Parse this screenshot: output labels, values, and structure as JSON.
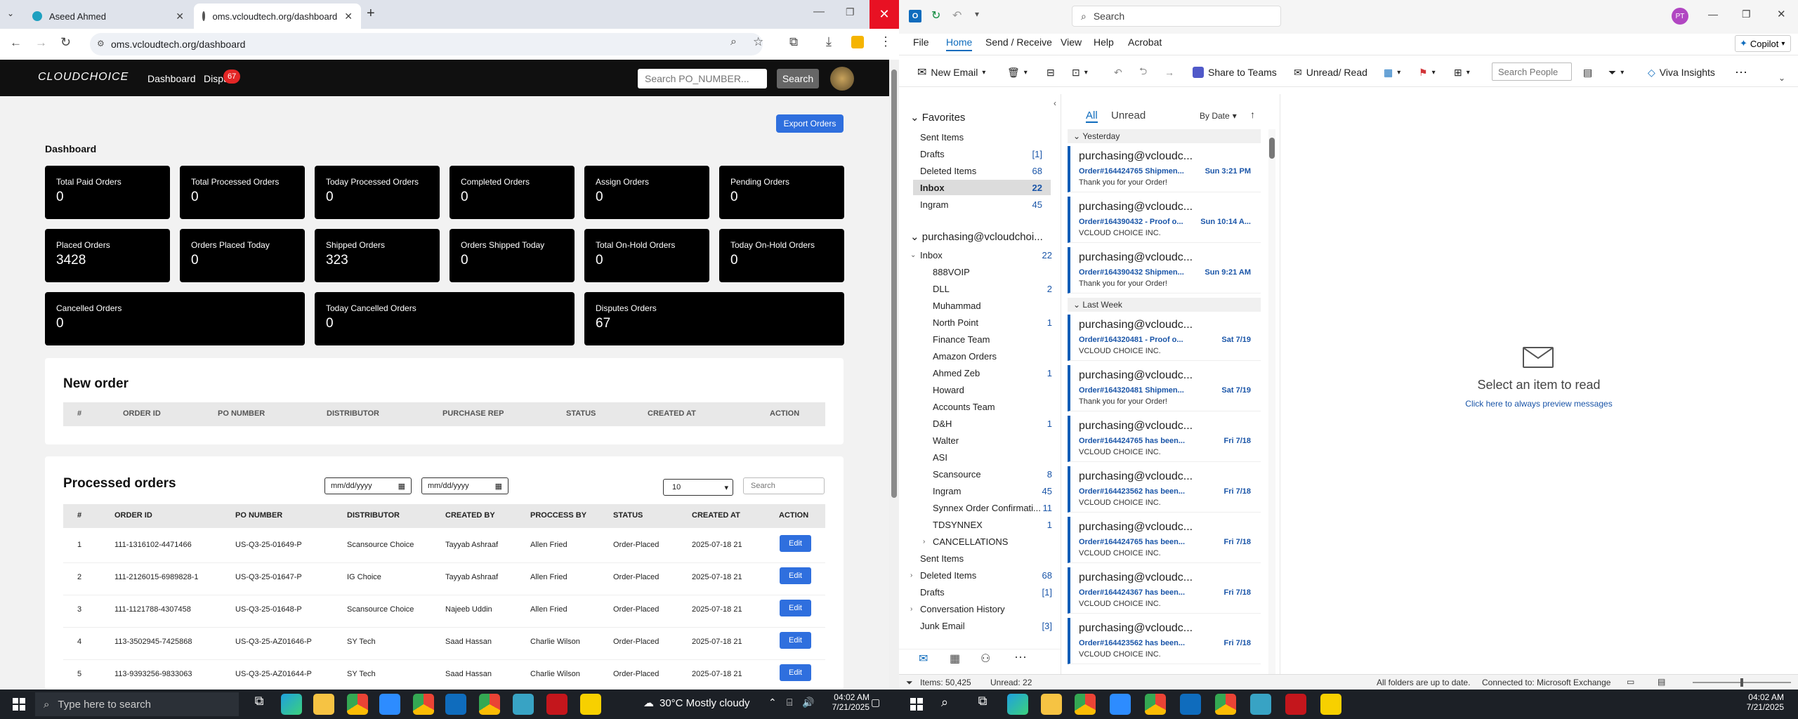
{
  "browser": {
    "tabs": [
      {
        "label": "Aseed Ahmed",
        "active": false
      },
      {
        "label": "oms.vcloudtech.org/dashboard",
        "active": true
      }
    ],
    "new_tab": "+",
    "url": "oms.vcloudtech.org/dashboard"
  },
  "oms": {
    "logo": "CLOUDCHOICE",
    "nav": {
      "dashboard": "Dashboard",
      "disputes": "Dispu",
      "disputes_badge": "67"
    },
    "search_placeholder": "Search PO_NUMBER...",
    "search_button": "Search",
    "export_button": "Export Orders",
    "page_title": "Dashboard",
    "cards": [
      {
        "label": "Total Paid Orders",
        "value": "0"
      },
      {
        "label": "Total Processed Orders",
        "value": "0"
      },
      {
        "label": "Today Processed Orders",
        "value": "0"
      },
      {
        "label": "Completed Orders",
        "value": "0"
      },
      {
        "label": "Assign Orders",
        "value": "0"
      },
      {
        "label": "Pending Orders",
        "value": "0"
      },
      {
        "label": "Placed Orders",
        "value": "3428"
      },
      {
        "label": "Orders Placed Today",
        "value": "0"
      },
      {
        "label": "Shipped Orders",
        "value": "323"
      },
      {
        "label": "Orders Shipped Today",
        "value": "0"
      },
      {
        "label": "Total On-Hold Orders",
        "value": "0"
      },
      {
        "label": "Today On-Hold Orders",
        "value": "0"
      },
      {
        "label": "Cancelled Orders",
        "value": "0"
      },
      {
        "label": "Today Cancelled Orders",
        "value": "0"
      },
      {
        "label": "Disputes Orders",
        "value": "67"
      }
    ],
    "new_order": {
      "title": "New order",
      "headers": [
        "#",
        "ORDER ID",
        "PO NUMBER",
        "DISTRIBUTOR",
        "PURCHASE REP",
        "STATUS",
        "CREATED AT",
        "ACTION"
      ]
    },
    "processed": {
      "title": "Processed orders",
      "date_placeholder": "mm/dd/yyyy",
      "page_size": "10",
      "search_placeholder": "Search",
      "headers": [
        "#",
        "ORDER ID",
        "PO NUMBER",
        "DISTRIBUTOR",
        "CREATED BY",
        "PROCCESS BY",
        "STATUS",
        "CREATED AT",
        "ACTION"
      ],
      "rows": [
        [
          "1",
          "111-1316102-4471466",
          "US-Q3-25-01649-P",
          "Scansource Choice",
          "Tayyab Ashraaf",
          "Allen Fried",
          "Order-Placed",
          "2025-07-18 21"
        ],
        [
          "2",
          "111-2126015-6989828-1",
          "US-Q3-25-01647-P",
          "IG Choice",
          "Tayyab Ashraaf",
          "Allen Fried",
          "Order-Placed",
          "2025-07-18 21"
        ],
        [
          "3",
          "111-1121788-4307458",
          "US-Q3-25-01648-P",
          "Scansource Choice",
          "Najeeb Uddin",
          "Allen Fried",
          "Order-Placed",
          "2025-07-18 21"
        ],
        [
          "4",
          "113-3502945-7425868",
          "US-Q3-25-AZ01646-P",
          "SY Tech",
          "Saad Hassan",
          "Charlie Wilson",
          "Order-Placed",
          "2025-07-18 21"
        ],
        [
          "5",
          "113-9393256-9833063",
          "US-Q3-25-AZ01644-P",
          "SY Tech",
          "Saad Hassan",
          "Charlie Wilson",
          "Order-Placed",
          "2025-07-18 21"
        ]
      ],
      "edit": "Edit"
    }
  },
  "outlook": {
    "search": "Search",
    "avatar": "PT",
    "copilot": "Copilot",
    "menu": [
      "File",
      "Home",
      "Send / Receive",
      "View",
      "Help",
      "Acrobat"
    ],
    "ribbon": {
      "new_email": "New Email",
      "share_teams": "Share to Teams",
      "unread_read": "Unread/ Read",
      "search_people": "Search People",
      "viva": "Viva Insights"
    },
    "favorites_label": "Favorites",
    "favorites": [
      {
        "name": "Sent Items",
        "count": ""
      },
      {
        "name": "Drafts",
        "count": "[1]"
      },
      {
        "name": "Deleted Items",
        "count": "68"
      },
      {
        "name": "Inbox",
        "count": "22"
      },
      {
        "name": "Ingram",
        "count": "45"
      }
    ],
    "account": "purchasing@vcloudchoi...",
    "folders": [
      {
        "name": "Inbox",
        "count": "22"
      },
      {
        "name": "888VOIP",
        "count": ""
      },
      {
        "name": "DLL",
        "count": "2"
      },
      {
        "name": "Muhammad",
        "count": ""
      },
      {
        "name": "North Point",
        "count": "1"
      },
      {
        "name": "Finance Team",
        "count": ""
      },
      {
        "name": "Amazon Orders",
        "count": ""
      },
      {
        "name": "Ahmed Zeb",
        "count": "1"
      },
      {
        "name": "Howard",
        "count": ""
      },
      {
        "name": "Accounts Team",
        "count": ""
      },
      {
        "name": "D&H",
        "count": "1"
      },
      {
        "name": "Walter",
        "count": ""
      },
      {
        "name": "ASI",
        "count": ""
      },
      {
        "name": "Scansource",
        "count": "8"
      },
      {
        "name": "Ingram",
        "count": "45"
      },
      {
        "name": "Synnex Order Confirmati...",
        "count": "11"
      },
      {
        "name": "TDSYNNEX",
        "count": "1"
      },
      {
        "name": "CANCELLATIONS",
        "count": ""
      },
      {
        "name": "Sent Items",
        "count": ""
      },
      {
        "name": "Deleted Items",
        "count": "68"
      },
      {
        "name": "Drafts",
        "count": "[1]"
      },
      {
        "name": "Conversation History",
        "count": ""
      },
      {
        "name": "Junk Email",
        "count": "[3]"
      }
    ],
    "filters": {
      "all": "All",
      "unread": "Unread",
      "sort": "By Date"
    },
    "groups": {
      "yesterday": "Yesterday",
      "last_week": "Last Week"
    },
    "messages": [
      {
        "sender": "purchasing@vcloudc...",
        "subject": "Order#164424765 Shipmen...",
        "date": "Sun 3:21 PM",
        "preview": "Thank you for your Order!"
      },
      {
        "sender": "purchasing@vcloudc...",
        "subject": "Order#164390432 - Proof o...",
        "date": "Sun 10:14 A...",
        "preview": "VCLOUD CHOICE INC."
      },
      {
        "sender": "purchasing@vcloudc...",
        "subject": "Order#164390432 Shipmen...",
        "date": "Sun 9:21 AM",
        "preview": "Thank you for your Order!"
      },
      {
        "sender": "purchasing@vcloudc...",
        "subject": "Order#164320481 - Proof o...",
        "date": "Sat 7/19",
        "preview": "VCLOUD CHOICE INC."
      },
      {
        "sender": "purchasing@vcloudc...",
        "subject": "Order#164320481 Shipmen...",
        "date": "Sat 7/19",
        "preview": "Thank you for your Order!"
      },
      {
        "sender": "purchasing@vcloudc...",
        "subject": "Order#164424765 has been...",
        "date": "Fri 7/18",
        "preview": "VCLOUD CHOICE INC."
      },
      {
        "sender": "purchasing@vcloudc...",
        "subject": "Order#164423562 has been...",
        "date": "Fri 7/18",
        "preview": "VCLOUD CHOICE INC."
      },
      {
        "sender": "purchasing@vcloudc...",
        "subject": "Order#164424765 has been...",
        "date": "Fri 7/18",
        "preview": "VCLOUD CHOICE INC."
      },
      {
        "sender": "purchasing@vcloudc...",
        "subject": "Order#164424367 has been...",
        "date": "Fri 7/18",
        "preview": "VCLOUD CHOICE INC."
      },
      {
        "sender": "purchasing@vcloudc...",
        "subject": "Order#164423562 has been...",
        "date": "Fri 7/18",
        "preview": "VCLOUD CHOICE INC."
      }
    ],
    "reading": {
      "title": "Select an item to read",
      "link": "Click here to always preview messages"
    },
    "status": {
      "items": "Items: 50,425",
      "unread": "Unread: 22",
      "folders": "All folders are up to date.",
      "connected": "Connected to: Microsoft Exchange"
    }
  },
  "taskbar": {
    "search": "Type here to search",
    "weather": "30°C  Mostly cloudy",
    "time": "04:02 AM",
    "date": "7/21/2025"
  }
}
